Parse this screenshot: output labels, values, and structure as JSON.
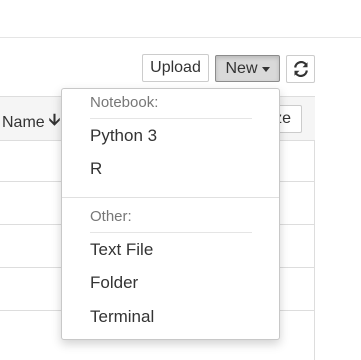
{
  "toolbar": {
    "upload_label": "Upload",
    "new_label": "New",
    "refresh_icon": "refresh-icon"
  },
  "list": {
    "name_header": "Name",
    "sort_icon": "sort-arrow-down-icon",
    "size_header_partial": "ze"
  },
  "new_menu": {
    "notebook_header": "Notebook:",
    "notebook_items": [
      "Python 3",
      "R"
    ],
    "other_header": "Other:",
    "other_items": [
      "Text File",
      "Folder",
      "Terminal"
    ]
  }
}
